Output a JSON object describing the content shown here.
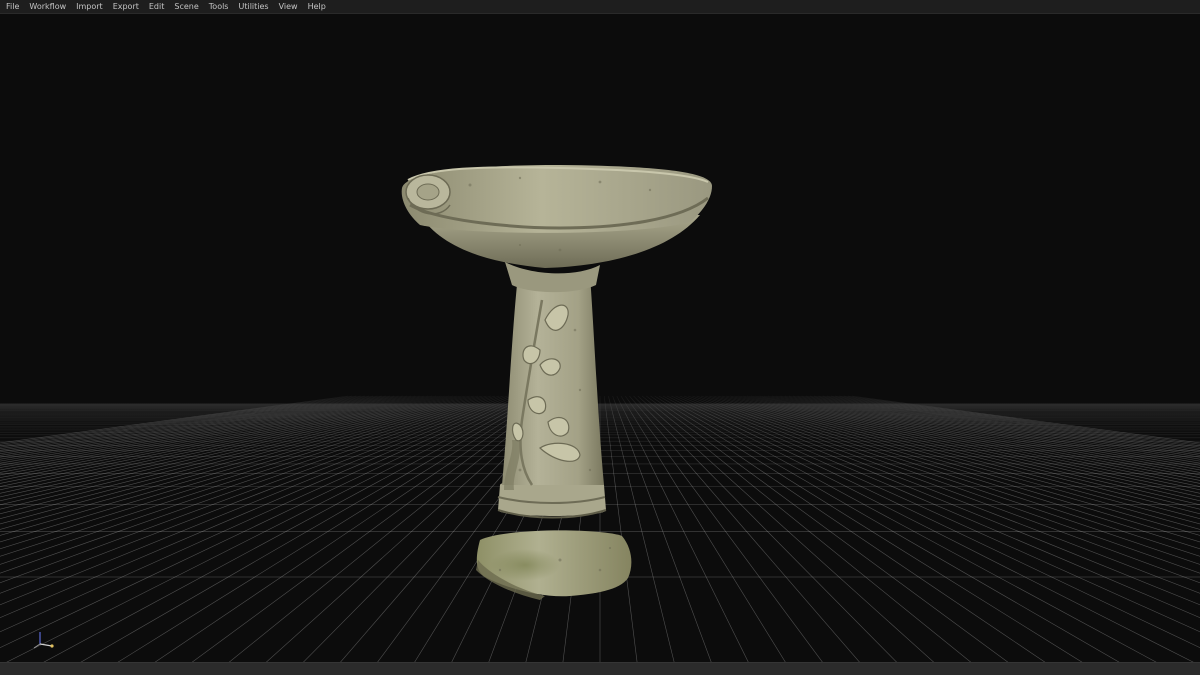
{
  "menubar": {
    "items": [
      {
        "label": "File"
      },
      {
        "label": "Workflow"
      },
      {
        "label": "Import"
      },
      {
        "label": "Export"
      },
      {
        "label": "Edit"
      },
      {
        "label": "Scene"
      },
      {
        "label": "Tools"
      },
      {
        "label": "Utilities"
      },
      {
        "label": "View"
      },
      {
        "label": "Help"
      }
    ]
  },
  "viewport": {
    "model": "stone-birdbath",
    "colors": {
      "background": "#0c0c0c",
      "grid": "#bcbcbc",
      "stone_light": "#b8b59a",
      "stone_mid": "#8f8c72",
      "stone_dark": "#5c5a48",
      "moss": "#7e8358"
    },
    "gizmo": {
      "axes": [
        "x",
        "y",
        "z"
      ]
    }
  },
  "statusbar": {}
}
